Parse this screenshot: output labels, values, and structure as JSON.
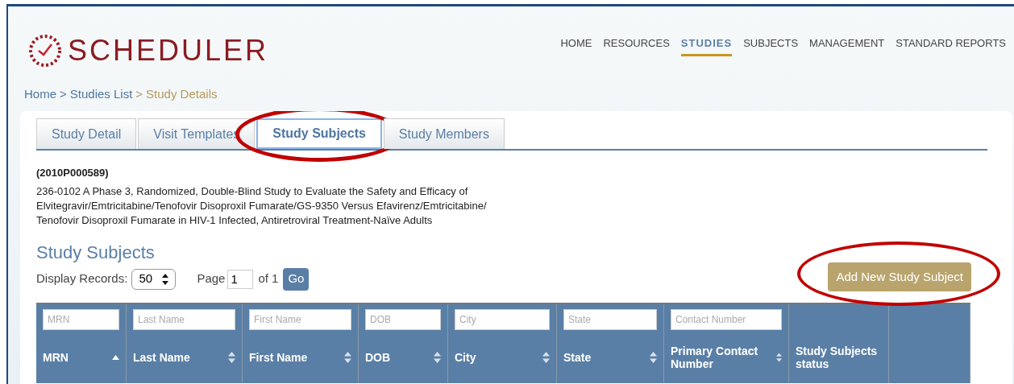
{
  "logo": {
    "text": "SCHEDULER"
  },
  "nav": [
    {
      "label": "HOME",
      "selected": false
    },
    {
      "label": "RESOURCES",
      "selected": false
    },
    {
      "label": "STUDIES",
      "selected": true
    },
    {
      "label": "SUBJECTS",
      "selected": false
    },
    {
      "label": "MANAGEMENT",
      "selected": false
    },
    {
      "label": "STANDARD REPORTS",
      "selected": false
    }
  ],
  "breadcrumb": [
    {
      "label": "Home",
      "current": false,
      "separator": ">"
    },
    {
      "label": "Studies List",
      "current": false,
      "separator": ">"
    },
    {
      "label": "Study Details",
      "current": true
    }
  ],
  "tabs": [
    {
      "label": "Study Detail",
      "selected": false,
      "circled": false
    },
    {
      "label": "Visit Templates",
      "selected": false,
      "circled": false
    },
    {
      "label": "Study Subjects",
      "selected": true,
      "circled": true
    },
    {
      "label": "Study Members",
      "selected": false,
      "circled": false
    }
  ],
  "study": {
    "id": "(2010P000589)",
    "title": "236-0102 A Phase 3, Randomized, Double-Blind Study to Evaluate the Safety and Efficacy of Elvitegravir/Emtricitabine/Tenofovir Disoproxil Fumarate/GS-9350 Versus Efavirenz/Emtricitabine/ Tenofovir Disoproxil Fumarate in HIV-1 Infected, Antiretroviral Treatment-Naïve Adults"
  },
  "section_title": "Study Subjects",
  "paging": {
    "display_label": "Display Records:",
    "display_value": "50",
    "page_label": "Page",
    "page_value": "1",
    "of_label": "of 1",
    "go_button": "Go"
  },
  "add_button": {
    "label": "Add New Study Subject",
    "circled": true
  },
  "table": {
    "columns": [
      {
        "filter_placeholder": "MRN",
        "label": "MRN",
        "sortable": true,
        "sorted_ascending": true
      },
      {
        "filter_placeholder": "Last Name",
        "label": "Last Name",
        "sortable": true
      },
      {
        "filter_placeholder": "First Name",
        "label": "First Name",
        "sortable": true
      },
      {
        "filter_placeholder": "DOB",
        "label": "DOB",
        "sortable": true
      },
      {
        "filter_placeholder": "City",
        "label": "City",
        "sortable": true
      },
      {
        "filter_placeholder": "State",
        "label": "State",
        "sortable": true
      },
      {
        "filter_placeholder": "Contact Number",
        "label": "Primary Contact Number",
        "sortable": true
      },
      {
        "label": "Study Subjects status",
        "sortable": false
      },
      {
        "sortable": false
      }
    ]
  }
}
